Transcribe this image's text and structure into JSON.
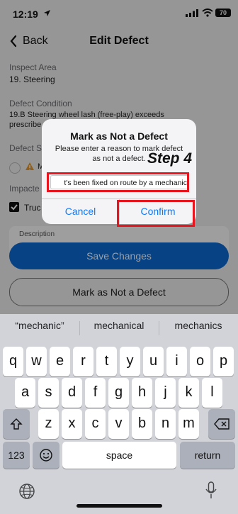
{
  "status": {
    "time": "12:19",
    "battery": "70"
  },
  "nav": {
    "back_label": "Back",
    "title": "Edit Defect"
  },
  "form": {
    "inspect_area_label": "Inspect Area",
    "inspect_area_value": "19. Steering",
    "defect_condition_label": "Defect Condition",
    "defect_condition_line1": "19.B Steering wheel lash (free-play) exceeds",
    "defect_condition_line2": "prescribe",
    "defect_severity_label": "Defect S",
    "severity_option_partial": "M",
    "impacted_label": "Impacte",
    "impacted_checkbox_label": "Truc",
    "description_label": "Description",
    "save_label": "Save Changes",
    "mark_label": "Mark as Not a Defect"
  },
  "dialog": {
    "title": "Mark as Not a Defect",
    "message_line1": "Please enter a reason to mark defect",
    "message_line2": "as not a defect.",
    "input_value": "t's been fixed on route by a mechanic",
    "cancel_label": "Cancel",
    "confirm_label": "Confirm"
  },
  "annotation": {
    "step_label": "Step 4",
    "highlight_color": "#e8141e"
  },
  "keyboard": {
    "suggestions": [
      "“mechanic”",
      "mechanical",
      "mechanics"
    ],
    "row1": [
      "q",
      "w",
      "e",
      "r",
      "t",
      "y",
      "u",
      "i",
      "o",
      "p"
    ],
    "row2": [
      "a",
      "s",
      "d",
      "f",
      "g",
      "h",
      "j",
      "k",
      "l"
    ],
    "row3": [
      "z",
      "x",
      "c",
      "v",
      "b",
      "n",
      "m"
    ],
    "numbers_label": "123",
    "space_label": "space",
    "return_label": "return"
  },
  "colors": {
    "primary": "#0a6bd6",
    "link": "#0a7aff"
  }
}
